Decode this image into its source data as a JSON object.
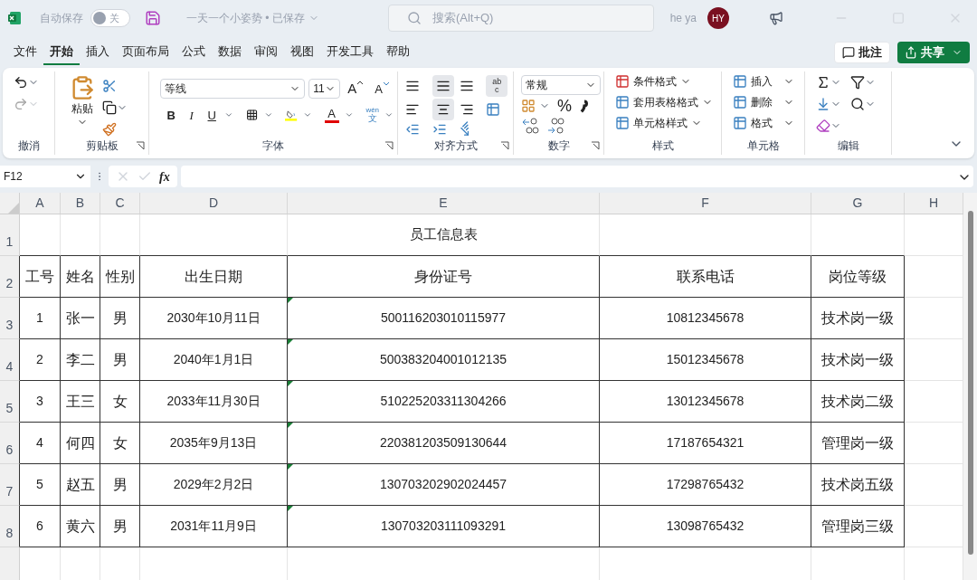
{
  "title_bar": {
    "autosave_label": "自动保存",
    "autosave_toggle": {
      "label": "关",
      "on": false
    },
    "document_title": "一天一个小姿势 • 已保存",
    "search_placeholder": "搜索(Alt+Q)",
    "user_name": "he ya",
    "avatar_initials": "HY"
  },
  "menu_tabs": [
    {
      "label": "文件",
      "selected": false
    },
    {
      "label": "开始",
      "selected": true
    },
    {
      "label": "插入",
      "selected": false
    },
    {
      "label": "页面布局",
      "selected": false
    },
    {
      "label": "公式",
      "selected": false
    },
    {
      "label": "数据",
      "selected": false
    },
    {
      "label": "审阅",
      "selected": false
    },
    {
      "label": "视图",
      "selected": false
    },
    {
      "label": "开发工具",
      "selected": false
    },
    {
      "label": "帮助",
      "selected": false
    }
  ],
  "comment_button": "批注",
  "share_button": "共享",
  "ribbon": {
    "undo_group": "撤消",
    "clipboard_group": "剪贴板",
    "paste_label": "粘贴",
    "font_group": "字体",
    "font_name": "等线",
    "font_size": "11",
    "grow_font": "A",
    "shrink_font": "A",
    "bold": "B",
    "italic": "I",
    "underline": "U",
    "font_color": "A",
    "phonetic": [
      "wén",
      "文"
    ],
    "alignment_group": "对齐方式",
    "wrap_text": [
      "ab",
      "c"
    ],
    "number_group": "数字",
    "number_format": "常规",
    "percent": "%",
    "styles_group": "样式",
    "styles": [
      "条件格式",
      "套用表格格式",
      "单元格样式"
    ],
    "cells_group": "单元格",
    "cell_actions": [
      "插入",
      "删除",
      "格式"
    ],
    "editing_group": "编辑"
  },
  "formula_bar": {
    "name_box": "F12",
    "function_button": "fx"
  },
  "sheet": {
    "columns": [
      "A",
      "B",
      "C",
      "D",
      "E",
      "F",
      "G",
      "H"
    ],
    "row_numbers": [
      "1",
      "2",
      "3",
      "4",
      "5",
      "6",
      "7",
      "8"
    ],
    "title_cell": "员工信息表",
    "header": [
      "工号",
      "姓名",
      "性别",
      "出生日期",
      "身份证号",
      "联系电话",
      "岗位等级"
    ],
    "records": [
      {
        "cells": [
          "1",
          "张一",
          "男",
          "2030年10月11日",
          "500116203010115977",
          "10812345678",
          "技术岗一级"
        ],
        "number_stored_as_text": true
      },
      {
        "cells": [
          "2",
          "李二",
          "男",
          "2040年1月1日",
          "500383204001012135",
          "15012345678",
          "技术岗一级"
        ],
        "number_stored_as_text": true
      },
      {
        "cells": [
          "3",
          "王三",
          "女",
          "2033年11月30日",
          "510225203311304266",
          "13012345678",
          "技术岗二级"
        ],
        "number_stored_as_text": true
      },
      {
        "cells": [
          "4",
          "何四",
          "女",
          "2035年9月13日",
          "220381203509130644",
          "17187654321",
          "管理岗一级"
        ],
        "number_stored_as_text": true
      },
      {
        "cells": [
          "5",
          "赵五",
          "男",
          "2029年2月2日",
          "130703202902024457",
          "17298765432",
          "技术岗五级"
        ],
        "number_stored_as_text": true
      },
      {
        "cells": [
          "6",
          "黄六",
          "男",
          "2031年11月9日",
          "130703203111093291",
          "13098765432",
          "管理岗三级"
        ],
        "number_stored_as_text": true
      }
    ]
  }
}
